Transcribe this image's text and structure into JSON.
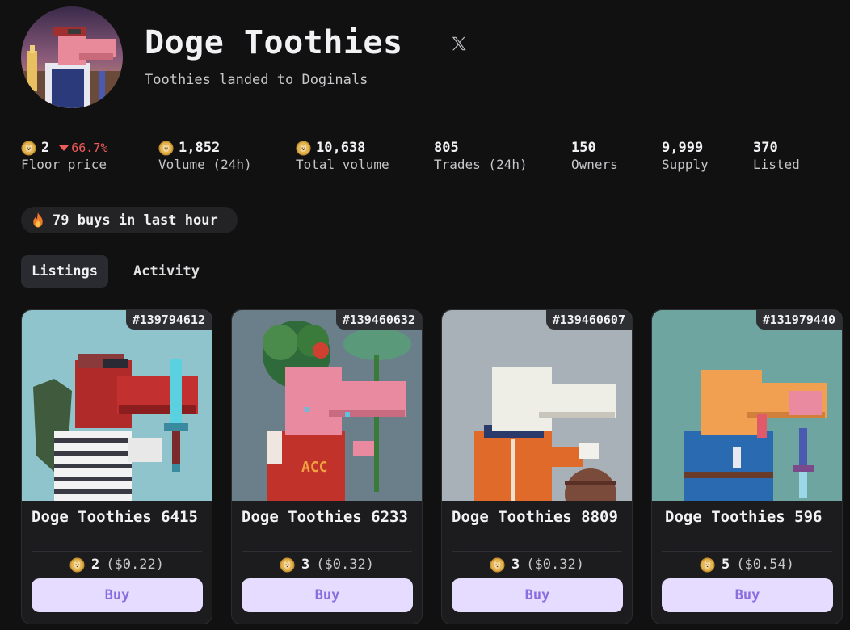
{
  "header": {
    "title": "Doge Toothies",
    "subtitle": "Toothies landed to Doginals",
    "social_icon": "x-icon"
  },
  "stats": {
    "floor_price": {
      "value": "2",
      "change": "66.7%",
      "change_direction": "down",
      "label": "Floor price"
    },
    "volume_24h": {
      "value": "1,852",
      "label": "Volume (24h)"
    },
    "total_volume": {
      "value": "10,638",
      "label": "Total volume"
    },
    "trades_24h": {
      "value": "805",
      "label": "Trades (24h)"
    },
    "owners": {
      "value": "150",
      "label": "Owners"
    },
    "supply": {
      "value": "9,999",
      "label": "Supply"
    },
    "listed": {
      "value": "370",
      "label": "Listed"
    }
  },
  "activity_pill": {
    "icon": "fire-icon",
    "text": "79 buys in last hour"
  },
  "tabs": [
    {
      "label": "Listings",
      "active": true
    },
    {
      "label": "Activity",
      "active": false
    }
  ],
  "listings": [
    {
      "id": "#139794612",
      "name": "Doge Toothies 6415",
      "price": "2",
      "usd": "($0.22)",
      "buy_label": "Buy"
    },
    {
      "id": "#139460632",
      "name": "Doge Toothies 6233",
      "price": "3",
      "usd": "($0.32)",
      "buy_label": "Buy"
    },
    {
      "id": "#139460607",
      "name": "Doge Toothies 8809",
      "price": "3",
      "usd": "($0.32)",
      "buy_label": "Buy"
    },
    {
      "id": "#131979440",
      "name": "Doge Toothies 596",
      "price": "5",
      "usd": "($0.54)",
      "buy_label": "Buy"
    }
  ],
  "colors": {
    "background": "#111112",
    "accent_button_bg": "#e6dcff",
    "accent_button_text": "#8a6ee0",
    "negative": "#ef5a5a",
    "coin": "#d9a641"
  }
}
